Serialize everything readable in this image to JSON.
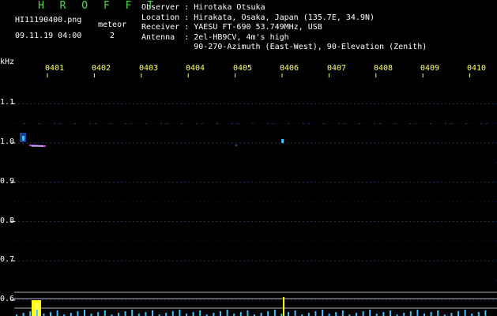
{
  "header": {
    "app_title": "H R O F F T",
    "filename": "HI11190400.png",
    "timestamp": "09.11.19 04:00",
    "meteor_label": "meteor",
    "meteor_count": "2"
  },
  "info": [
    {
      "label": "Observer",
      "value": "Hirotaka Otsuka"
    },
    {
      "label": "Location",
      "value": "Hirakata, Osaka, Japan (135.7E, 34.9N)"
    },
    {
      "label": "Receiver",
      "value": "YAESU FT-690 53.749MHz, USB"
    },
    {
      "label": "Antenna ",
      "value": "2el-HB9CV, 4m's high"
    },
    {
      "label": "",
      "value": "90-270-Azimuth (East-West), 90-Elevation (Zenith)"
    }
  ],
  "chart_data": {
    "type": "heatmap",
    "ylabel": "kHz",
    "x_ticks": [
      "0401",
      "0402",
      "0403",
      "0404",
      "0405",
      "0406",
      "0407",
      "0408",
      "0409",
      "0410"
    ],
    "y_ticks": [
      "1.1",
      "1.0",
      "0.9",
      "0.8",
      "0.7",
      "0.6"
    ],
    "ylim": [
      0.58,
      1.12
    ],
    "grid": true,
    "colors": {
      "background": "#000000",
      "grid": "#1e3a5c",
      "ticks": "#ffff66",
      "signal": "#40c0ff"
    }
  }
}
